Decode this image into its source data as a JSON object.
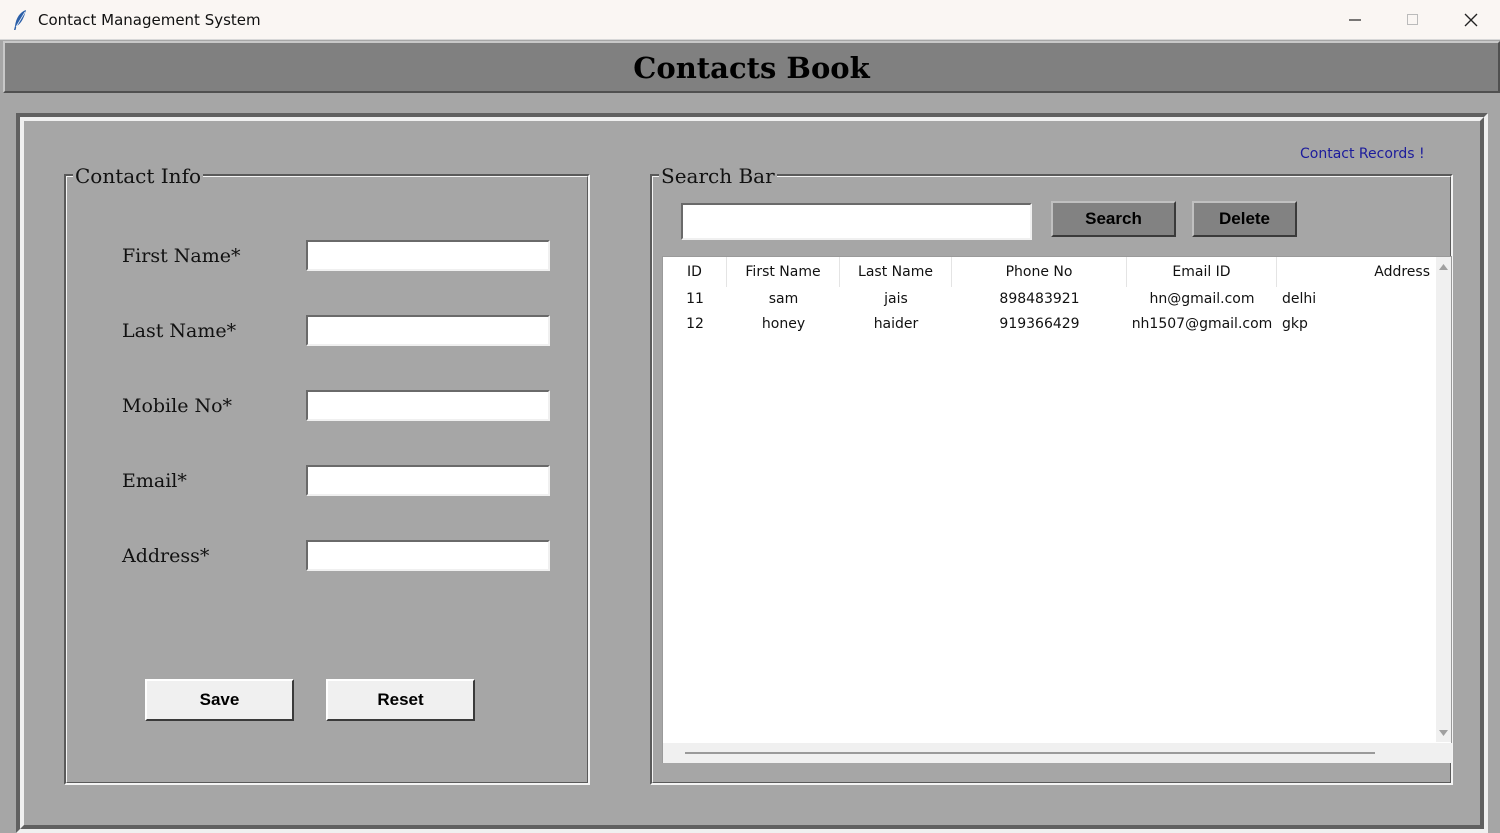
{
  "window": {
    "title": "Contact Management System"
  },
  "header": {
    "title": "Contacts Book"
  },
  "records_label": "Contact Records !",
  "contact_info": {
    "title": "Contact Info",
    "fields": [
      {
        "label": "First Name*",
        "value": ""
      },
      {
        "label": "Last Name*",
        "value": ""
      },
      {
        "label": "Mobile No*",
        "value": ""
      },
      {
        "label": "Email*",
        "value": ""
      },
      {
        "label": "Address*",
        "value": ""
      }
    ],
    "save_label": "Save",
    "reset_label": "Reset"
  },
  "search": {
    "title": "Search Bar",
    "value": "",
    "search_label": "Search",
    "delete_label": "Delete"
  },
  "table": {
    "columns": [
      "ID",
      "First Name",
      "Last Name",
      "Phone No",
      "Email ID",
      "Address"
    ],
    "rows": [
      [
        "11",
        "sam",
        "jais",
        "898483921",
        "hn@gmail.com",
        "delhi"
      ],
      [
        "12",
        "honey",
        "haider",
        "919366429",
        "nh1507@gmail.com",
        "gkp"
      ]
    ]
  },
  "icons": {
    "app": "feather-icon",
    "minimize": "minimize-icon",
    "maximize": "maximize-icon",
    "close": "close-icon",
    "scroll_up": "arrow-up-icon",
    "scroll_down": "arrow-down-icon"
  }
}
